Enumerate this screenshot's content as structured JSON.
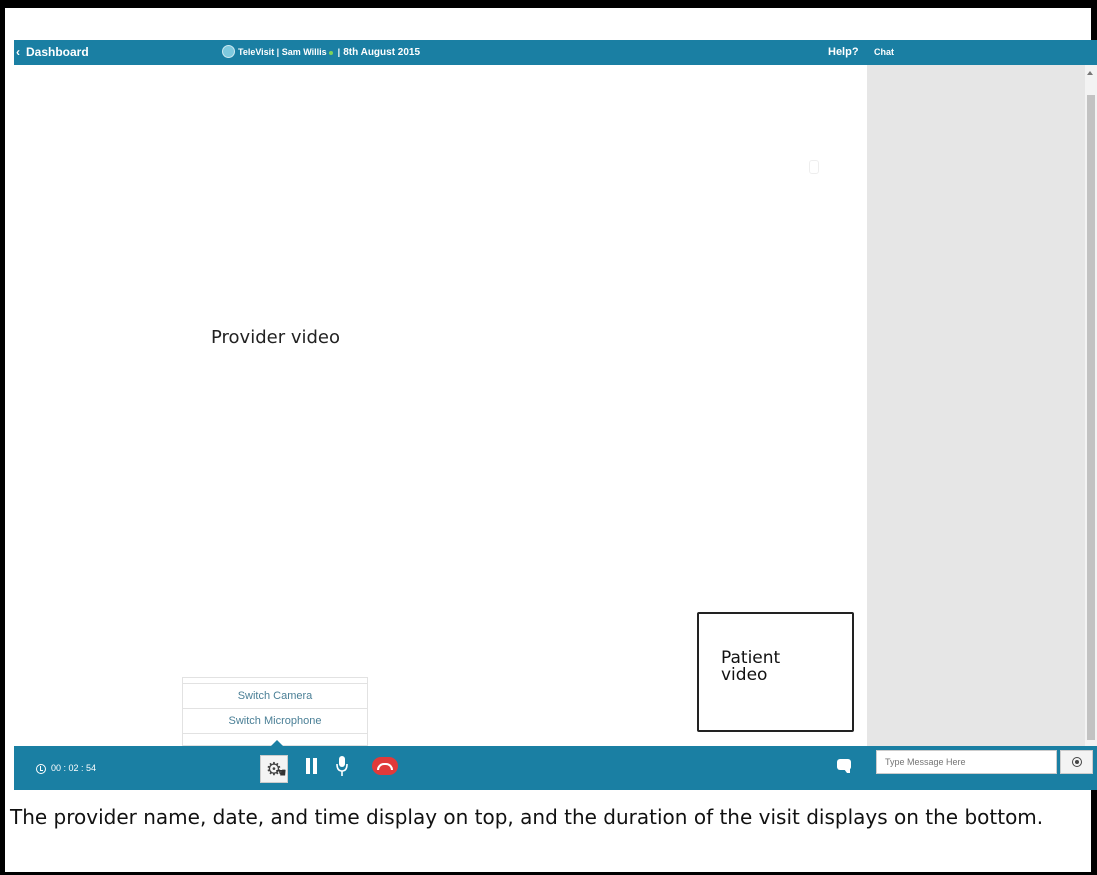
{
  "header": {
    "back_label": "Dashboard",
    "app_name": "TeleVisit |",
    "provider_name": "Sam Willis",
    "separator": "|",
    "date": "8th August 2015",
    "help_label": "Help?",
    "chat_title": "Chat"
  },
  "main": {
    "provider_video_label": "Provider video",
    "patient_video_label": "Patient video"
  },
  "settings_menu": {
    "items": [
      "Switch Camera",
      "Switch Microphone"
    ]
  },
  "controls": {
    "timer": "00 : 02 : 54",
    "icons": [
      "gear-icon",
      "pause-icon",
      "microphone-icon",
      "end-call-icon",
      "chat-bubble-icon"
    ]
  },
  "chat": {
    "input_placeholder": "Type Message Here"
  },
  "caption": "The provider name, date, and time display on top, and the duration of the visit displays on the bottom.",
  "colors": {
    "brand": "#1a7fa3",
    "end_call": "#e03a3a",
    "online_status": "#7ed35a",
    "chat_bg": "#e6e6e6"
  }
}
